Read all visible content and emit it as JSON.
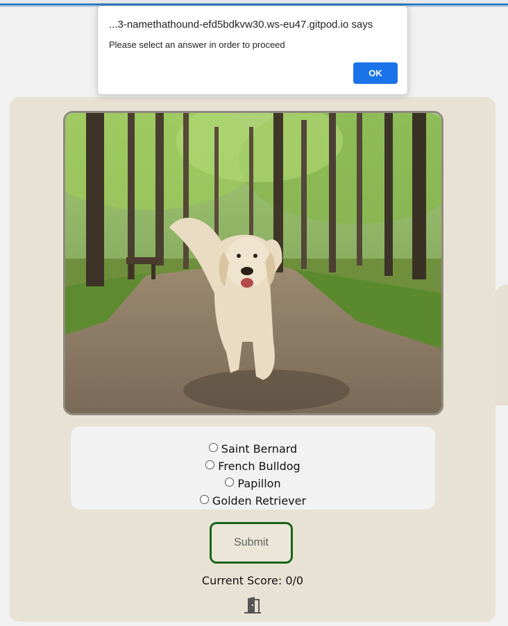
{
  "dialog": {
    "title": "...3-namethathound-efd5bdkvw30.ws-eu47.gitpod.io says",
    "message": "Please select an answer in order to proceed",
    "ok_label": "OK"
  },
  "quiz": {
    "options": [
      {
        "label": "Saint Bernard"
      },
      {
        "label": "French Bulldog"
      },
      {
        "label": "Papillon"
      },
      {
        "label": "Golden Retriever"
      }
    ],
    "submit_label": "Submit",
    "score_text": "Current Score: 0/0"
  },
  "icons": {
    "exit": "door-exit-icon"
  },
  "colors": {
    "card_bg": "#e8e2d5",
    "submit_border": "#176418",
    "ok_button": "#1a73e8"
  }
}
